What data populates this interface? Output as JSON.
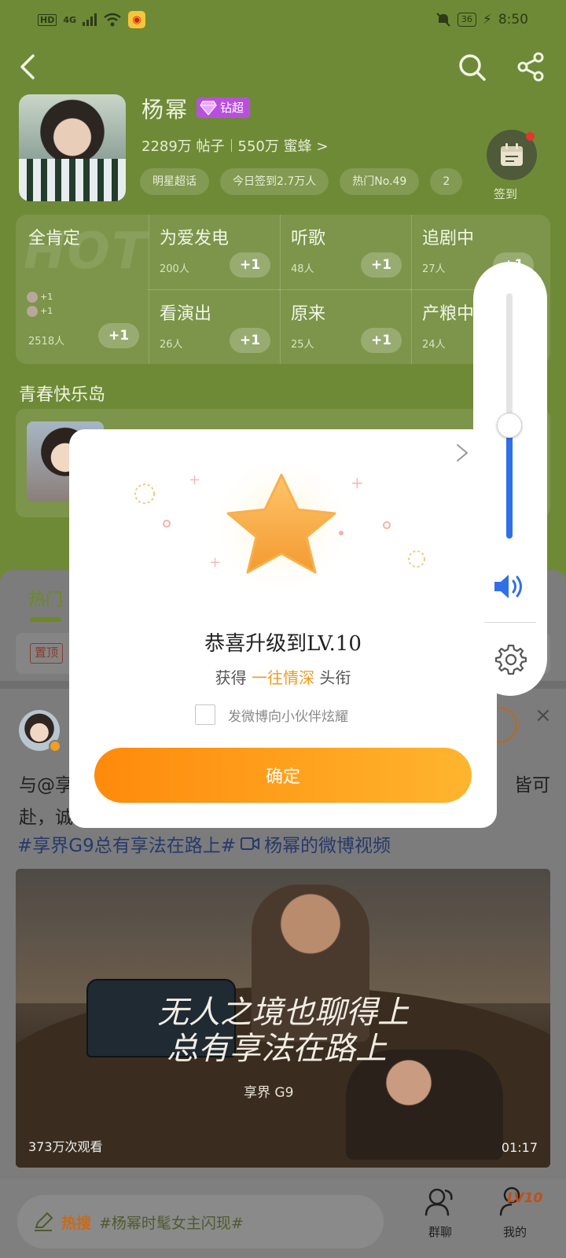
{
  "status_bar": {
    "hd_label": "HD",
    "network": "4G",
    "battery": "36",
    "time": "8:50"
  },
  "profile": {
    "name": "杨幂",
    "badge": "钻超",
    "posts": "2289万 帖子",
    "fans": "550万 蜜蜂 >",
    "tags": [
      "明星超话",
      "今日签到2.7万人",
      "热门No.49",
      "2"
    ],
    "checkin_label": "签到"
  },
  "grid": {
    "watermark": "HOT",
    "cells": [
      {
        "title": "全肯定",
        "count": "2518人",
        "plus": "+1"
      },
      {
        "title": "为爱发电",
        "count": "200人",
        "plus": "+1"
      },
      {
        "title": "听歌",
        "count": "48人",
        "plus": "+1"
      },
      {
        "title": "追剧中",
        "count": "27人",
        "plus": "+1"
      },
      {
        "title": "看演出",
        "count": "26人",
        "plus": "+1"
      },
      {
        "title": "原来",
        "count": "25人",
        "plus": "+1"
      },
      {
        "title": "产粮中",
        "count": "24人",
        "plus": "+1"
      }
    ],
    "mini_plus": [
      "+1",
      "+1"
    ]
  },
  "section": {
    "title": "青春快乐岛"
  },
  "feed": {
    "tab_hot": "热门",
    "pinned_badge": "置顶"
  },
  "post": {
    "text_line1_start": "与@享",
    "text_line1_end": "皆可",
    "text_line2": "赴，诚",
    "hashtag": "#享界G9总有享法在路上#",
    "video_link": "杨幂的微博视频",
    "video": {
      "slogan_line1": "无人之境也聊得上",
      "slogan_line2": "总有享法在路上",
      "brand": "享界 G9",
      "views": "373万次观看",
      "duration": "01:17"
    }
  },
  "bottom_bar": {
    "hot_label": "热搜",
    "hot_topic": "#杨幂时髦女主闪现#",
    "group_chat_label": "群聊",
    "me_label": "我的",
    "level_badge": "LV10"
  },
  "dialog": {
    "title": "恭喜升级到LV.10",
    "reward_prefix": "获得",
    "reward_item": "一往情深",
    "reward_suffix": "头衔",
    "share_label": "发微博向小伙伴炫耀",
    "confirm_label": "确定"
  },
  "volume": {
    "level": 0.46,
    "accent_color": "#2f70e8"
  },
  "colors": {
    "header_green": "#6e8a36",
    "confirm_orange": "#ff8a0b",
    "star_gold": "#f29a1d"
  }
}
